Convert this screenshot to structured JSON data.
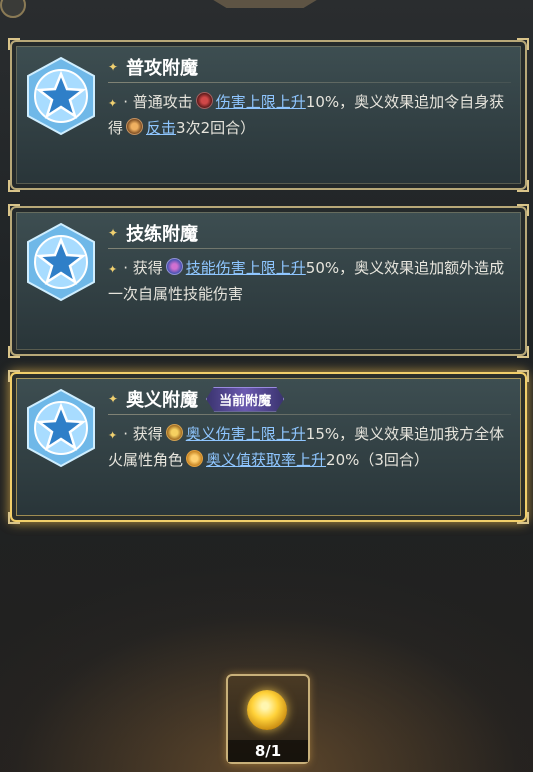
{
  "cards": [
    {
      "title": "普攻附魔",
      "desc": {
        "pre": "· 普通攻击",
        "kw1": "伤害上限上升",
        "mid": "10%，奥义效果追加令自身获得",
        "kw2": "反击",
        "post": "3次2回合）"
      }
    },
    {
      "title": "技练附魔",
      "desc": {
        "pre": "· 获得",
        "kw1": "技能伤害上限上升",
        "post": "50%，奥义效果追加额外造成一次自属性技能伤害"
      }
    },
    {
      "title": "奥义附魔",
      "tag": "当前附魔",
      "desc": {
        "pre": "· 获得",
        "kw1": "奥义伤害上限上升",
        "mid": "15%，奥义效果追加我方全体火属性角色",
        "kw2": "奥义值获取率上升",
        "post": "20%（3回合）"
      }
    }
  ],
  "token": {
    "count": "8/1"
  },
  "colors": {
    "accent_gold": "#f2cf6a",
    "keyword": "#8fc6ff",
    "tag": "#6b5ab0"
  },
  "icons": [
    "star-badge-icon",
    "attack-icon",
    "counter-icon",
    "skill-icon",
    "ultimate-icon",
    "energy-icon",
    "fire-orb-icon"
  ]
}
